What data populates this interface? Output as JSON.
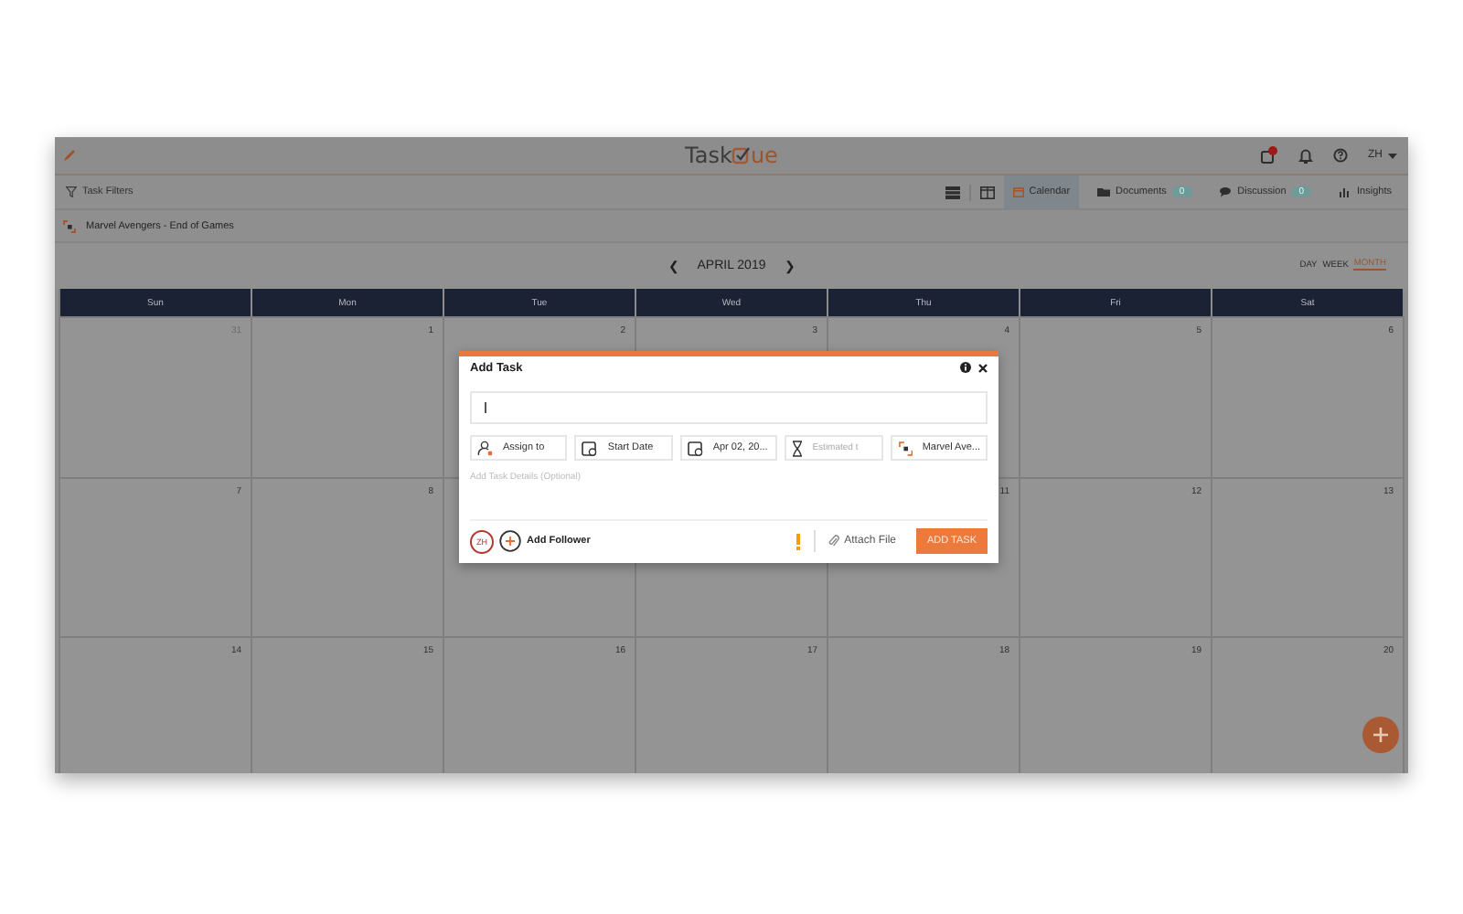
{
  "app": {
    "logo_parts": [
      "Task",
      "ue"
    ],
    "user": "ZH"
  },
  "toolbar": {
    "filters": "Task Filters",
    "tabs": [
      {
        "label": "Calendar",
        "selected": true
      },
      {
        "label": "Documents",
        "badge": "0",
        "selected": false
      },
      {
        "label": "Discussion",
        "badge": "0",
        "selected": false
      },
      {
        "label": "Insights",
        "selected": false
      }
    ]
  },
  "project": {
    "name": "Marvel Avengers - End of Games"
  },
  "calendar": {
    "month": "APRIL 2019",
    "prev": "❮",
    "next": "❯",
    "views": [
      {
        "label": "DAY",
        "selected": false
      },
      {
        "label": "WEEK",
        "selected": false
      },
      {
        "label": "MONTH",
        "selected": true
      }
    ],
    "weekdays": [
      "Sun",
      "Mon",
      "Tue",
      "Wed",
      "Thu",
      "Fri",
      "Sat"
    ],
    "weeks": [
      {
        "days": [
          {
            "day": "31",
            "other_month": true
          },
          {
            "day": "1",
            "other_month": false
          },
          {
            "day": "2",
            "other_month": false
          },
          {
            "day": "3",
            "other_month": false
          },
          {
            "day": "4",
            "other_month": false
          },
          {
            "day": "5",
            "other_month": false
          },
          {
            "day": "6",
            "other_month": false
          }
        ]
      },
      {
        "days": [
          {
            "day": "7",
            "other_month": false
          },
          {
            "day": "8",
            "other_month": false
          }
        ],
        "days_after_dialog": [
          {
            "day": "11",
            "other_month": false
          },
          {
            "day": "12",
            "other_month": false
          },
          {
            "day": "13",
            "other_month": false
          }
        ]
      },
      {
        "days": [
          {
            "day": "14",
            "other_month": false
          },
          {
            "day": "15",
            "other_month": false
          },
          {
            "day": "16",
            "other_month": false
          },
          {
            "day": "17",
            "other_month": false
          },
          {
            "day": "18",
            "other_month": false
          },
          {
            "day": "19",
            "other_month": false
          },
          {
            "day": "20",
            "other_month": false
          }
        ]
      }
    ]
  },
  "dialog": {
    "title": "Add Task",
    "chips": [
      {
        "kind": "assignee",
        "label": "Assign to",
        "placeholder": false
      },
      {
        "kind": "start-date",
        "label": "Start Date",
        "placeholder": false
      },
      {
        "kind": "due-date",
        "label": "Apr 02, 20...",
        "placeholder": false
      },
      {
        "kind": "estimate",
        "label": "Estimated t",
        "placeholder": true
      },
      {
        "kind": "project",
        "label": "Marvel Ave...",
        "placeholder": false
      }
    ],
    "details_placeholder": "Add Task Details (Optional)",
    "follower_avatar": "ZH",
    "add_follower": "Add Follower",
    "attach": "Attach File",
    "submit": "ADD TASK"
  }
}
